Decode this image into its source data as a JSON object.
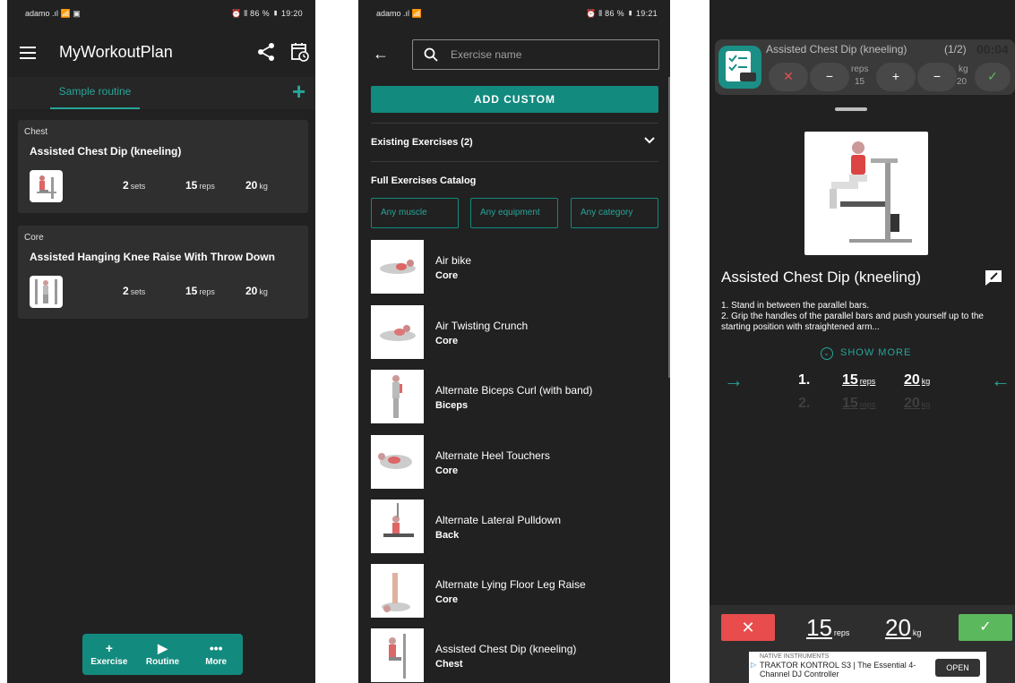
{
  "phone1": {
    "status": {
      "left": "adamo .ıl 📶 ▣",
      "right": "⏰ ⫴ 86 % ▮ 19:20"
    },
    "app_title": "MyWorkoutPlan",
    "tab": "Sample routine",
    "add": "+",
    "cards": [
      {
        "category": "Chest",
        "name": "Assisted Chest Dip (kneeling)",
        "sets": "2",
        "sets_unit": "sets",
        "reps": "15",
        "reps_unit": "reps",
        "kg": "20",
        "kg_unit": "kg"
      },
      {
        "category": "Core",
        "name": "Assisted Hanging Knee Raise With Throw Down",
        "sets": "2",
        "sets_unit": "sets",
        "reps": "15",
        "reps_unit": "reps",
        "kg": "20",
        "kg_unit": "kg"
      }
    ],
    "fab": [
      {
        "icon": "+",
        "label": "Exercise"
      },
      {
        "icon": "▶",
        "label": "Routine"
      },
      {
        "icon": "•••",
        "label": "More"
      }
    ]
  },
  "phone2": {
    "status": {
      "left": "adamo .ıl 📶",
      "right": "⏰ ⫴ 86 % ▮ 19:21"
    },
    "search_placeholder": "Exercise name",
    "add_custom": "ADD CUSTOM",
    "existing": "Existing Exercises (2)",
    "catalog": "Full Exercises Catalog",
    "filters": [
      "Any muscle",
      "Any equipment",
      "Any category"
    ],
    "exercises": [
      {
        "name": "Air bike",
        "category": "Core"
      },
      {
        "name": "Air Twisting Crunch",
        "category": "Core"
      },
      {
        "name": "Alternate Biceps Curl (with band)",
        "category": "Biceps"
      },
      {
        "name": "Alternate Heel Touchers",
        "category": "Core"
      },
      {
        "name": "Alternate Lateral Pulldown",
        "category": "Back"
      },
      {
        "name": "Alternate Lying Floor Leg Raise",
        "category": "Core"
      },
      {
        "name": "Assisted Chest Dip (kneeling)",
        "category": "Chest"
      }
    ]
  },
  "phone3": {
    "mini": {
      "title": "Assisted Chest Dip (kneeling)",
      "count": "(1/2)",
      "timer": "00:04",
      "reps_label": "reps",
      "reps_value": "15",
      "kg_label": "kg",
      "kg_value": "20",
      "cancel": "✕",
      "minus": "−",
      "plus": "+",
      "ok": "✓"
    },
    "title": "Assisted Chest Dip (kneeling)",
    "instructions_1": "1. Stand in between the parallel bars.",
    "instructions_2": "2. Grip the handles of the parallel bars and push yourself up to the starting position with straightened arm...",
    "show_more": "SHOW MORE",
    "sets": [
      {
        "num": "1.",
        "reps": "15",
        "reps_unit": "reps",
        "kg": "20",
        "kg_unit": "kg"
      },
      {
        "num": "2.",
        "reps": "15",
        "reps_unit": "reps",
        "kg": "20",
        "kg_unit": "kg"
      }
    ],
    "bottom": {
      "cancel": "✕",
      "reps": "15",
      "reps_unit": "reps",
      "kg": "20",
      "kg_unit": "kg",
      "ok": "✓"
    },
    "ad": {
      "brand": "NATIVE INSTRUMENTS",
      "text": "TRAKTOR KONTROL S3 | The Essential 4-Channel DJ Controller",
      "button": "OPEN"
    }
  },
  "colors": {
    "accent": "#138a7e",
    "accent_light": "#26a69a",
    "background": "#212121",
    "cancel": "#e84c4c",
    "confirm": "#5cb85c"
  }
}
